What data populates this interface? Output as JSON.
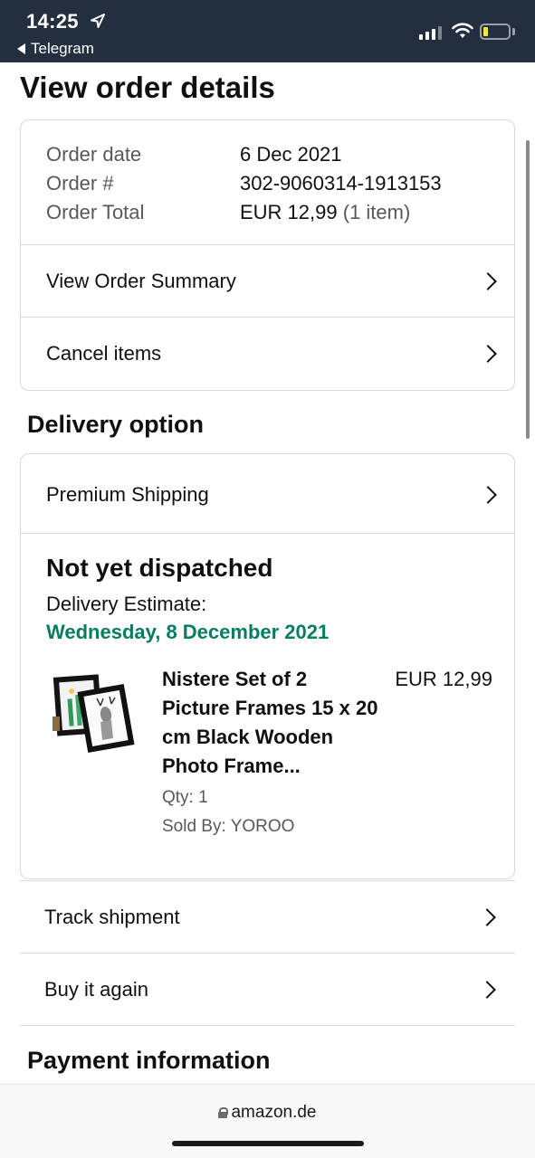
{
  "status_bar": {
    "time": "14:25",
    "back_label": "Telegram"
  },
  "page": {
    "title": "View order details"
  },
  "order_info": {
    "rows": [
      {
        "label": "Order date",
        "value": "6 Dec 2021",
        "extra": ""
      },
      {
        "label": "Order #",
        "value": "302-9060314-1913153",
        "extra": ""
      },
      {
        "label": "Order Total",
        "value": "EUR 12,99",
        "extra": "(1 item)"
      }
    ],
    "links": [
      {
        "label": "View Order Summary"
      },
      {
        "label": "Cancel items"
      }
    ]
  },
  "delivery": {
    "section_title": "Delivery option",
    "shipping_label": "Premium Shipping",
    "status": "Not yet dispatched",
    "estimate_label": "Delivery Estimate:",
    "estimate_date": "Wednesday, 8 December 2021",
    "estimate_color": "#067d62",
    "product": {
      "name": "Nistere Set of 2 Picture Frames 15 x 20 cm Black Wooden Photo Frame...",
      "price": "EUR 12,99",
      "qty": "Qty: 1",
      "seller": "Sold By: YOROO",
      "image_icon": "picture-frames-product-image"
    }
  },
  "actions": [
    {
      "label": "Track shipment"
    },
    {
      "label": "Buy it again"
    }
  ],
  "payment": {
    "section_title": "Payment information"
  },
  "browser": {
    "url": "amazon.de"
  },
  "colors": {
    "header_bg": "#232f3e",
    "border": "#d5d9d9",
    "muted_text": "#565959"
  }
}
